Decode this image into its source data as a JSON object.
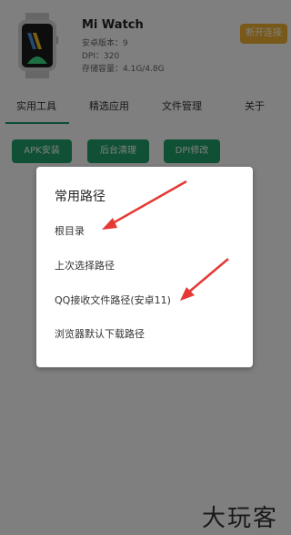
{
  "header": {
    "device_name": "Mi Watch",
    "android_version": "安卓版本：9",
    "dpi": "DPI：320",
    "storage": "存储容量：4.1G/4.8G",
    "disconnect_label": "断开连接"
  },
  "tabs": [
    "实用工具",
    "精选应用",
    "文件管理",
    "关于"
  ],
  "tools": [
    "APK安装",
    "后台清理",
    "DPI修改"
  ],
  "dialog": {
    "title": "常用路径",
    "items": [
      "根目录",
      "上次选择路径",
      "QQ接收文件路径(安卓11)",
      "浏览器默认下载路径"
    ]
  },
  "watermark": "大玩客",
  "colors": {
    "accent_green": "#21a36c",
    "disconnect_orange": "#f2b233",
    "arrow_red": "#e53935"
  }
}
